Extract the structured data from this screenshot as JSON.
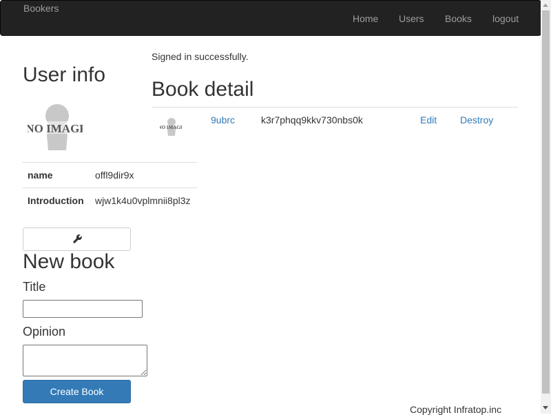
{
  "navbar": {
    "brand": "Bookers",
    "links": [
      "Home",
      "Users",
      "Books",
      "logout"
    ]
  },
  "flash": "Signed in successfully.",
  "user_info": {
    "heading": "User info",
    "avatar_text": "NO IMAGE",
    "rows": [
      {
        "label": "name",
        "value": "offl9dir9x"
      },
      {
        "label": "Introduction",
        "value": "wjw1k4u0vplmnii8pl3z"
      }
    ],
    "edit_icon": "wrench-icon"
  },
  "new_book": {
    "heading": "New book",
    "title_label": "Title",
    "title_value": "",
    "opinion_label": "Opinion",
    "opinion_value": "",
    "submit_label": "Create Book"
  },
  "book_detail": {
    "heading": "Book detail",
    "thumb_text": "NO IMAGE",
    "title": "9ubrc",
    "opinion": "k3r7phqq9kkv730nbs0k",
    "edit_label": "Edit",
    "destroy_label": "Destroy"
  },
  "footer": "Copyright Infratop.inc",
  "colors": {
    "navbar_bg": "#222222",
    "nav_text": "#9d9d9d",
    "link": "#337ab7",
    "primary_button": "#337ab7"
  }
}
